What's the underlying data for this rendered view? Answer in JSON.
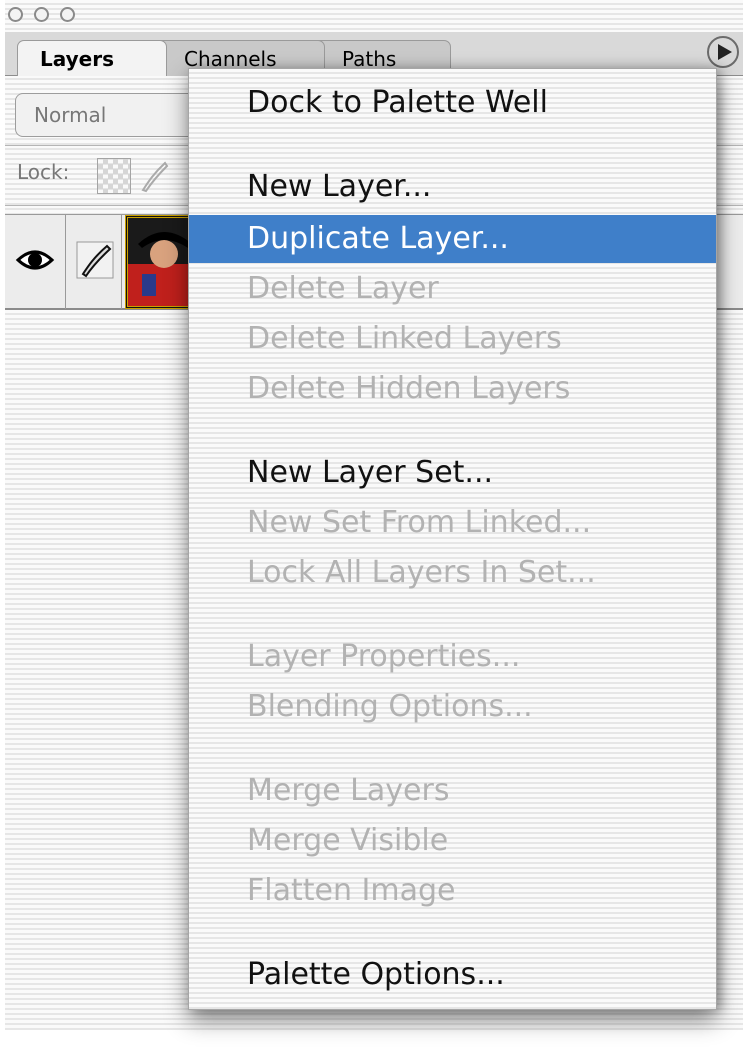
{
  "palette": {
    "tabs": [
      "Layers",
      "Channels",
      "Paths"
    ],
    "blend_mode": "Normal",
    "lock_label": "Lock:"
  },
  "menu": {
    "items": [
      {
        "label": "Dock to Palette Well",
        "enabled": true
      },
      {
        "label": "New Layer...",
        "enabled": true
      },
      {
        "label": "Duplicate Layer...",
        "enabled": true,
        "highlighted": true
      },
      {
        "label": "Delete Layer",
        "enabled": false
      },
      {
        "label": "Delete Linked Layers",
        "enabled": false
      },
      {
        "label": "Delete Hidden Layers",
        "enabled": false
      },
      {
        "label": "New Layer Set...",
        "enabled": true
      },
      {
        "label": "New Set From Linked...",
        "enabled": false
      },
      {
        "label": "Lock All Layers In Set...",
        "enabled": false
      },
      {
        "label": "Layer Properties...",
        "enabled": false
      },
      {
        "label": "Blending Options...",
        "enabled": false
      },
      {
        "label": "Merge Layers",
        "enabled": false
      },
      {
        "label": "Merge Visible",
        "enabled": false
      },
      {
        "label": "Flatten Image",
        "enabled": false
      },
      {
        "label": "Palette Options...",
        "enabled": true
      }
    ]
  },
  "colors": {
    "highlight": "#3f7fc9",
    "enabled_text": "#111111",
    "disabled_text": "#b2b2b2"
  },
  "icons": [
    "eye-icon",
    "brush-icon",
    "layer-thumbnail",
    "palette-menu-arrow-icon",
    "lock-transparency-icon",
    "lock-brush-icon"
  ]
}
